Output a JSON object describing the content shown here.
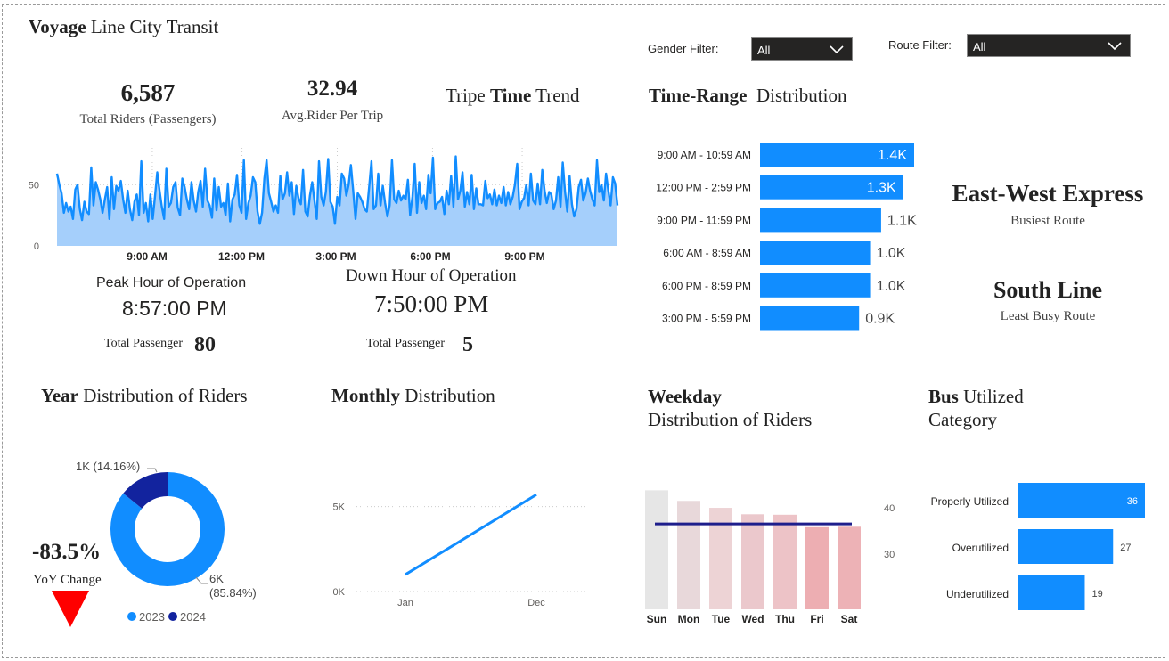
{
  "header": {
    "title_bold": "Voyage",
    "title_rest": " Line City Transit"
  },
  "filters": {
    "gender_label": "Gender Filter:",
    "gender_value": "All",
    "route_label": "Route Filter:",
    "route_value": "All"
  },
  "kpis": {
    "total_riders_value": "6,587",
    "total_riders_label": "Total Riders (Passengers)",
    "avg_rider_value": "32.94",
    "avg_rider_label": "Avg.Rider Per Trip",
    "peak_label": "Peak Hour of Operation",
    "peak_value": "8:57:00 PM",
    "peak_pass_label": "Total Passenger",
    "peak_pass_value": "80",
    "down_label": "Down Hour of Operation",
    "down_value": "7:50:00 PM",
    "down_pass_label": "Total Passenger",
    "down_pass_value": "5",
    "busiest_route": "East-West Express",
    "busiest_label": "Busiest Route",
    "least_route": "South Line",
    "least_label": "Least Busy Route",
    "yoy_value": "-83.5%",
    "yoy_label": "YoY Change"
  },
  "titles": {
    "trend_pre": "Tripe ",
    "trend_bold": "Time",
    "trend_post": " Trend",
    "timerange_bold": "Time-Range",
    "timerange_rest": "Distribution",
    "year_bold": "Year",
    "year_rest": " Distribution of Riders",
    "monthly_bold": "Monthly",
    "monthly_rest": " Distribution",
    "weekday_bold": "Weekday",
    "weekday_rest": "Distribution of Riders",
    "bus_bold": "Bus",
    "bus_rest1": " Utilized",
    "bus_rest2": "Category"
  },
  "colors": {
    "accent": "#118DFF",
    "area": "#A5CFFB",
    "dark_blue": "#12239E",
    "down_red": "#FF0000",
    "line_dark": "#1E1E8C"
  },
  "chart_data": [
    {
      "id": "trip-time-trend",
      "type": "area",
      "x_ticks": [
        "9:00 AM",
        "12:00 PM",
        "3:00 PM",
        "6:00 PM",
        "9:00 PM"
      ],
      "y_ticks": [
        "0",
        "50"
      ],
      "ylim": [
        0,
        80
      ],
      "values": [
        59,
        50,
        43,
        27,
        35,
        28,
        32,
        22,
        46,
        50,
        30,
        21,
        36,
        28,
        26,
        64,
        33,
        52,
        46,
        38,
        27,
        38,
        48,
        22,
        56,
        30,
        49,
        45,
        53,
        38,
        27,
        45,
        30,
        21,
        36,
        42,
        25,
        69,
        27,
        35,
        20,
        42,
        22,
        40,
        60,
        45,
        32,
        22,
        63,
        32,
        35,
        48,
        52,
        31,
        25,
        55,
        48,
        38,
        30,
        52,
        37,
        28,
        44,
        53,
        32,
        63,
        37,
        33,
        23,
        55,
        29,
        48,
        32,
        35,
        25,
        51,
        20,
        38,
        42,
        58,
        33,
        27,
        70,
        22,
        35,
        41,
        56,
        52,
        28,
        18,
        27,
        55,
        70,
        43,
        36,
        28,
        33,
        27,
        57,
        38,
        43,
        60,
        41,
        52,
        26,
        49,
        39,
        34,
        62,
        28,
        24,
        41,
        52,
        37,
        22,
        69,
        40,
        33,
        44,
        71,
        36,
        32,
        18,
        40,
        33,
        59,
        55,
        41,
        50,
        66,
        45,
        22,
        43,
        40,
        36,
        30,
        28,
        48,
        69,
        30,
        33,
        59,
        33,
        49,
        35,
        24,
        33,
        70,
        38,
        35,
        45,
        37,
        41,
        38,
        54,
        25,
        40,
        67,
        27,
        52,
        35,
        41,
        30,
        58,
        43,
        72,
        30,
        35,
        36,
        40,
        26,
        45,
        34,
        57,
        32,
        73,
        38,
        45,
        60,
        32,
        44,
        34,
        58,
        30,
        47,
        34,
        34,
        33,
        53,
        39,
        42,
        34,
        46,
        33,
        41,
        35,
        48,
        33,
        44,
        34,
        40,
        50,
        67,
        30,
        36,
        39,
        50,
        33,
        59,
        37,
        34,
        51,
        34,
        62,
        45,
        35,
        44,
        42,
        30,
        37,
        56,
        32,
        68,
        44,
        28,
        57,
        34,
        24,
        30,
        48,
        54,
        37,
        43,
        55,
        45,
        38,
        33,
        70,
        44,
        50,
        37,
        59,
        45,
        33,
        56,
        51,
        33
      ]
    },
    {
      "id": "time-range-distribution",
      "type": "bar",
      "orientation": "horizontal",
      "categories": [
        "9:00 AM - 10:59 AM",
        "12:00 PM - 2:59 PM",
        "9:00 PM - 11:59 PM",
        "6:00 AM - 8:59 AM",
        "6:00 PM - 8:59 PM",
        "3:00 PM - 5:59 PM"
      ],
      "values": [
        1400,
        1300,
        1100,
        1000,
        1000,
        900
      ],
      "labels": [
        "1.4K",
        "1.3K",
        "1.1K",
        "1.0K",
        "1.0K",
        "0.9K"
      ]
    },
    {
      "id": "year-distribution",
      "type": "pie",
      "donut": true,
      "categories": [
        "2023",
        "2024"
      ],
      "values": [
        85.84,
        14.16
      ],
      "labels": [
        "6K\n(85.84%)",
        "1K (14.16%)"
      ],
      "legend": "bottom"
    },
    {
      "id": "monthly-distribution",
      "type": "line",
      "x": [
        "Jan",
        "Dec"
      ],
      "values": [
        1000,
        5700
      ],
      "y_ticks": [
        "0K",
        "5K"
      ],
      "ylim": [
        0,
        6500
      ]
    },
    {
      "id": "weekday-distribution",
      "type": "bar",
      "categories": [
        "Sun",
        "Mon",
        "Tue",
        "Wed",
        "Thu",
        "Fri",
        "Sat"
      ],
      "values": [
        43.8,
        41.5,
        40.0,
        38.6,
        38.5,
        35.8,
        35.9
      ],
      "colors": [
        "#E6E6E6",
        "#E8D8DA",
        "#EDD3D5",
        "#EBC8CC",
        "#EDC3C7",
        "#EDAEB2",
        "#EDB2B6"
      ],
      "average": 36.5,
      "y_ticks": [
        "30",
        "40"
      ],
      "ylim": [
        18,
        45.8
      ]
    },
    {
      "id": "bus-utilized-category",
      "type": "bar",
      "orientation": "horizontal",
      "categories": [
        "Properly Utilized",
        "Overutilized",
        "Underutilized"
      ],
      "values": [
        36,
        27,
        19
      ]
    }
  ]
}
